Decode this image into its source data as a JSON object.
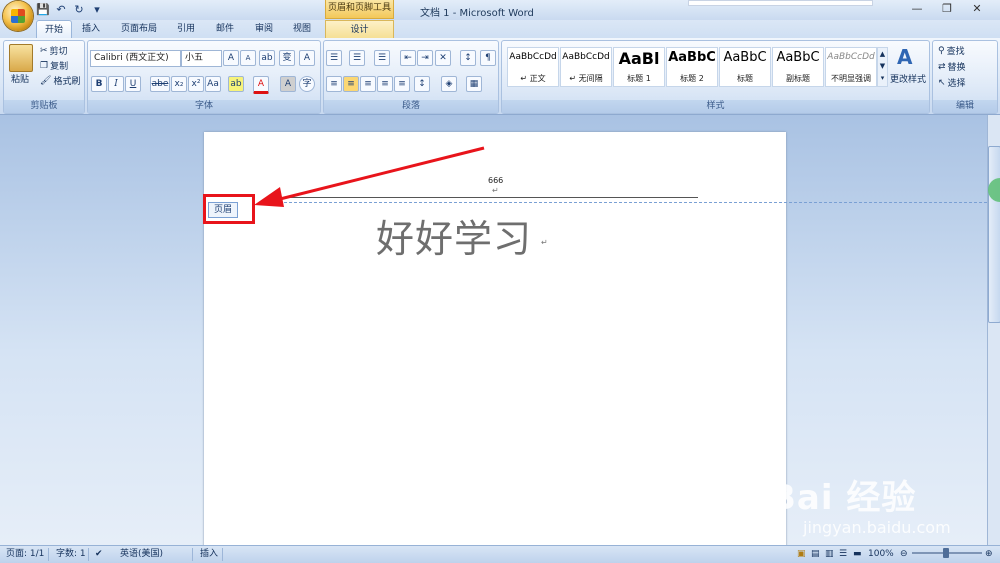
{
  "window": {
    "title": "文档 1 - Microsoft Word",
    "contextual_tools": "页眉和页脚工具",
    "controls": {
      "minimize": "—",
      "restore": "❐",
      "close": "✕"
    }
  },
  "quick_access": {
    "save": "💾",
    "undo": "↶",
    "redo": "↻",
    "more": "▾"
  },
  "tabs": [
    {
      "label": "开始",
      "active": true
    },
    {
      "label": "插入"
    },
    {
      "label": "页面布局"
    },
    {
      "label": "引用"
    },
    {
      "label": "邮件"
    },
    {
      "label": "审阅"
    },
    {
      "label": "视图"
    },
    {
      "label": "设计"
    }
  ],
  "clipboard": {
    "paste": "粘贴",
    "cut": "剪切",
    "copy": "复制",
    "format_painter": "格式刷",
    "group": "剪贴板"
  },
  "font": {
    "family": "Calibri (西文正文)",
    "size": "小五",
    "grow": "A",
    "shrink": "A",
    "clear": "ab",
    "phonetic": "变",
    "border": "A",
    "bold": "B",
    "italic": "I",
    "underline": "U",
    "strike": "abe",
    "subscript": "x₂",
    "superscript": "x²",
    "case": "Aa",
    "highlight": "ab",
    "color": "A",
    "shade": "A",
    "enclose": "字",
    "group": "字体"
  },
  "paragraph": {
    "group": "段落"
  },
  "styles": {
    "group": "样式",
    "change": "更改样式",
    "items": [
      {
        "preview": "AaBbCcDd",
        "name": "↵ 正文"
      },
      {
        "preview": "AaBbCcDd",
        "name": "↵ 无间隔"
      },
      {
        "preview": "AaBl",
        "name": "标题 1"
      },
      {
        "preview": "AaBbC",
        "name": "标题 2"
      },
      {
        "preview": "AaBbC",
        "name": "标题"
      },
      {
        "preview": "AaBbC",
        "name": "副标题"
      },
      {
        "preview": "AaBbCcDd",
        "name": "不明显强调"
      }
    ]
  },
  "editing": {
    "find": "查找",
    "replace": "替换",
    "select": "选择",
    "group": "编辑"
  },
  "document": {
    "header_text": "666",
    "para_mark": "↵",
    "header_label": "页眉",
    "body_text": "好好学习"
  },
  "status": {
    "page": "页面: 1/1",
    "words": "字数: 1",
    "language": "英语(美国)",
    "mode": "插入",
    "zoom": "100%"
  },
  "watermark": {
    "brand": "Bai 经验",
    "url": "jingyan.baidu.com"
  },
  "colors": {
    "annotation_red": "#e8141b",
    "accent": "#15325c"
  }
}
